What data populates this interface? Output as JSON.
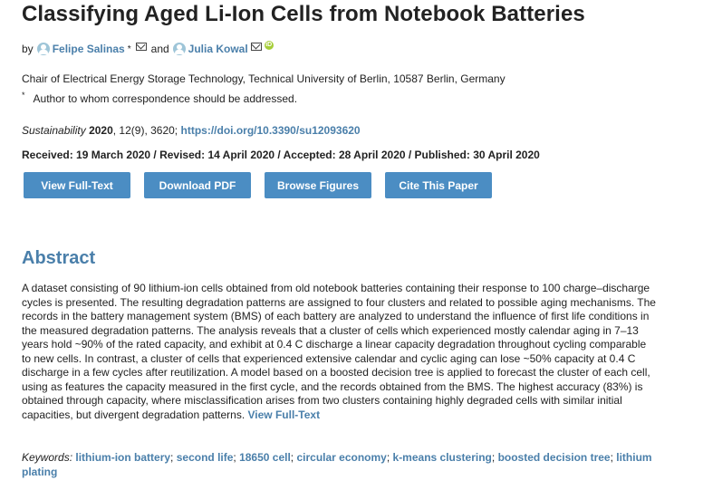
{
  "article": {
    "title": "Classifying Aged Li-Ion Cells from Notebook Batteries",
    "by": "by",
    "authors": [
      {
        "name": "Felipe Salinas",
        "marker": "*"
      },
      {
        "name": "Julia Kowal"
      }
    ],
    "and": "and",
    "orcid": "iD",
    "affiliation": "Chair of Electrical Energy Storage Technology, Technical University of Berlin, 10587 Berlin, Germany",
    "correspondence_marker": "*",
    "correspondence": "Author to whom correspondence should be addressed.",
    "citation": {
      "journal": "Sustainability",
      "year": "2020",
      "volume_issue": ", 12(9), 3620;",
      "doi": "https://doi.org/10.3390/su12093620"
    },
    "dates": "Received: 19 March 2020 / Revised: 14 April 2020 / Accepted: 28 April 2020 / Published: 30 April 2020"
  },
  "buttons": {
    "full_text": "View Full-Text",
    "download_pdf": "Download PDF",
    "browse_figures": "Browse Figures",
    "cite": "Cite This Paper"
  },
  "abstract": {
    "heading": "Abstract",
    "text": "A dataset consisting of 90 lithium-ion cells obtained from old notebook batteries containing their response to 100 charge–discharge cycles is presented. The resulting degradation patterns are assigned to four clusters and related to possible aging mechanisms. The records in the battery management system (BMS) of each battery are analyzed to understand the influence of first life conditions in the measured degradation patterns. The analysis reveals that a cluster of cells which experienced mostly calendar aging in 7–13 years hold ~90% of the rated capacity, and exhibit at 0.4 C discharge a linear capacity degradation throughout cycling comparable to new cells. In contrast, a cluster of cells that experienced extensive calendar and cyclic aging can lose ~50% capacity at 0.4 C discharge in a few cycles after reutilization. A model based on a boosted decision tree is applied to forecast the cluster of each cell, using as features the capacity measured in the first cycle, and the records obtained from the BMS. The highest accuracy (83%) is obtained through capacity, where misclassification arises from two clusters containing highly degraded cells with similar initial capacities, but divergent degradation patterns.",
    "full_text_link": "View Full-Text"
  },
  "keywords": {
    "label": "Keywords:",
    "items": [
      "lithium-ion battery",
      "second life",
      "18650 cell",
      "circular economy",
      "k-means clustering",
      "boosted decision tree",
      "lithium plating"
    ]
  }
}
